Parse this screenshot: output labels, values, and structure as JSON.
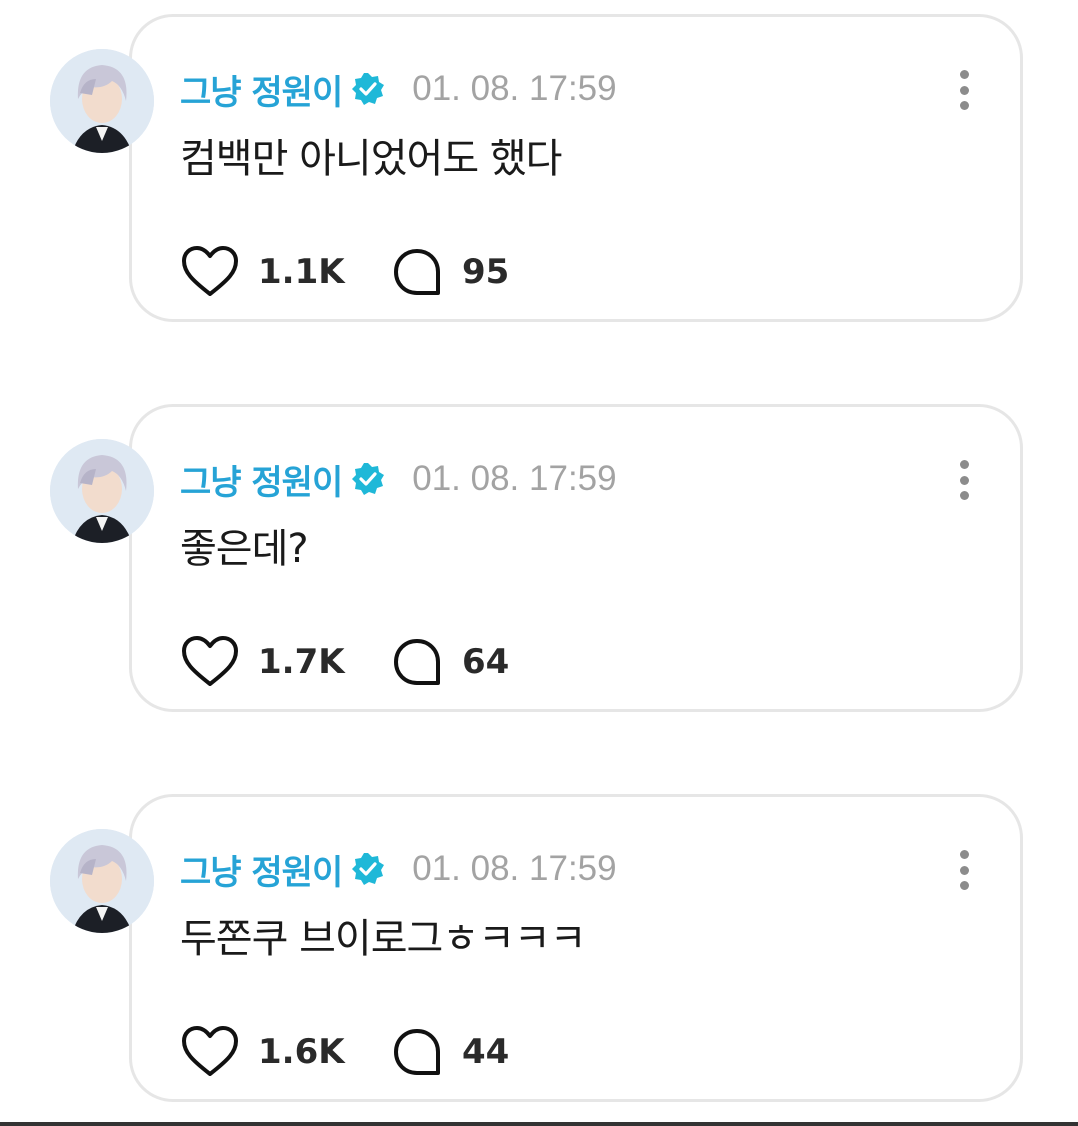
{
  "posts": [
    {
      "author": "그냥 정원이",
      "timestamp": "01. 08. 17:59",
      "text": "컴백만 아니었어도 했다",
      "likes": "1.1K",
      "comments": "95"
    },
    {
      "author": "그냥 정원이",
      "timestamp": "01. 08. 17:59",
      "text": "좋은데?",
      "likes": "1.7K",
      "comments": "64"
    },
    {
      "author": "그냥 정원이",
      "timestamp": "01. 08. 17:59",
      "text": "두쫀쿠 브이로그ㅎㅋㅋㅋ",
      "likes": "1.6K",
      "comments": "44"
    }
  ],
  "colors": {
    "author": "#26a3d6",
    "verified_badge": "#1fb8d8",
    "timestamp": "#a3a3a3",
    "card_border": "#e6e6e6"
  },
  "icons": {
    "verified": "verified-badge-icon",
    "menu": "more-vertical-icon",
    "like": "heart-icon",
    "comment": "speech-bubble-icon"
  }
}
